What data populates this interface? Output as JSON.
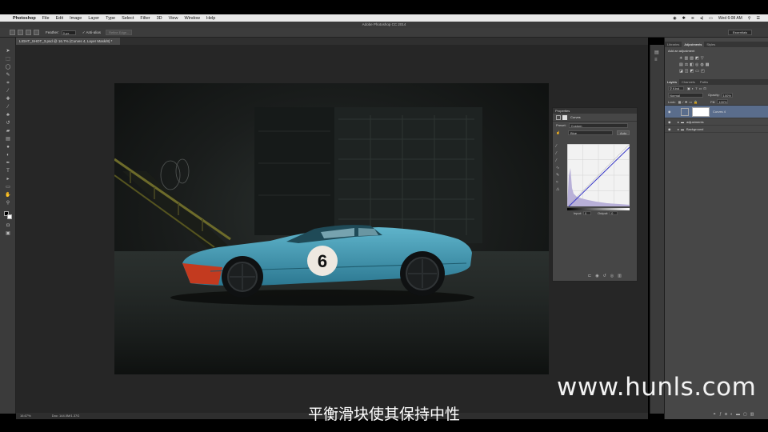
{
  "menubar": {
    "app": "Photoshop",
    "items": [
      "File",
      "Edit",
      "Image",
      "Layer",
      "Type",
      "Select",
      "Filter",
      "3D",
      "View",
      "Window",
      "Help"
    ],
    "clock": "Wed 6:08 AM"
  },
  "titlebar": {
    "title": "Adobe Photoshop CC 2014"
  },
  "options": {
    "feather_label": "Feather:",
    "feather_value": "0 px",
    "antialias_label": "Anti-alias",
    "refine_edge": "Refine Edge...",
    "workspace": "Essentials"
  },
  "document_tab": {
    "label": "LIGHT_SHOT_3.psd @ 16.7% (Curves 4, Layer Mask/8) *"
  },
  "status": {
    "zoom": "16.67%",
    "doc": "Doc: 144.0M/1.37G"
  },
  "properties": {
    "title": "Properties",
    "adjustment": "Curves",
    "preset_label": "Preset:",
    "preset_value": "Custom",
    "channel_value": "Blue",
    "auto_label": "Auto",
    "input_label": "Input:",
    "input_value": "0",
    "output_label": "Output:",
    "output_value": "0"
  },
  "right_panel": {
    "top_tabs": [
      "Libraries",
      "Adjustments",
      "Styles"
    ],
    "add_adjustment": "Add an adjustment",
    "layer_tabs": [
      "Layers",
      "Channels",
      "Paths"
    ],
    "kind_label": "Kind",
    "blend_mode": "Normal",
    "opacity_label": "Opacity:",
    "opacity_value": "100%",
    "lock_label": "Lock:",
    "fill_label": "Fill:",
    "fill_value": "100%",
    "layers": [
      {
        "name": "Curves 4"
      },
      {
        "name": "adjustments"
      },
      {
        "name": "Background"
      }
    ]
  },
  "photo": {
    "car_number": "6"
  },
  "subtitle": "平衡滑块使其保持中性",
  "watermark": "www.hunls.com",
  "colors": {
    "car_blue": "#3f95ae",
    "car_orange": "#c33a1f",
    "panel_bg": "#474747",
    "selected_layer": "#5a6d8c"
  }
}
